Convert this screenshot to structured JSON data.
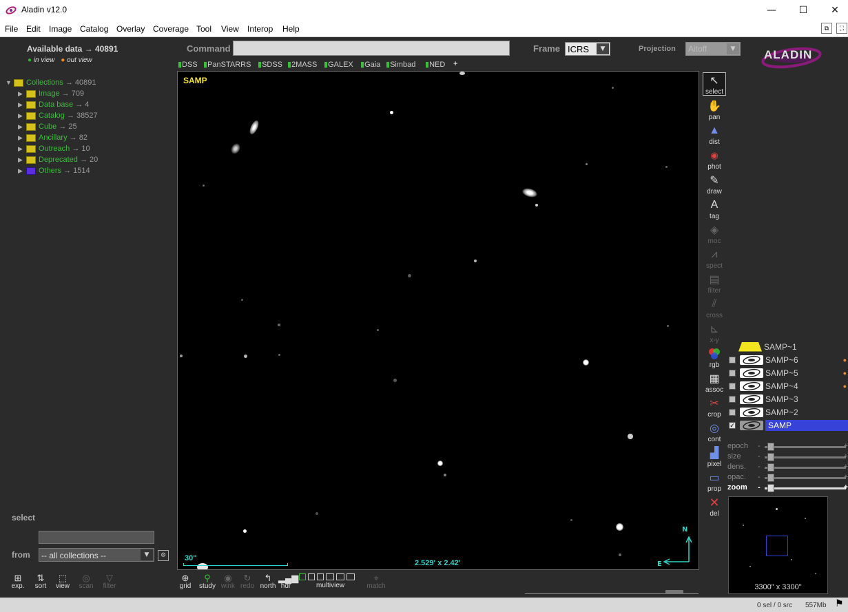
{
  "window": {
    "title": "Aladin v12.0",
    "minimize": "—",
    "maximize": "☐",
    "close": "✕"
  },
  "menu": [
    "File",
    "Edit",
    "Image",
    "Catalog",
    "Overlay",
    "Coverage",
    "Tool",
    "View",
    "Interop",
    "Help"
  ],
  "header": {
    "available_label": "Available data →",
    "available_count": "40891",
    "in_view": "in view",
    "out_view": "out view",
    "command_label": "Command",
    "command_value": "",
    "frame_label": "Frame",
    "frame_value": "ICRS",
    "projection_label": "Projection",
    "projection_value": "Aitoff",
    "logo_text": "ALADIN"
  },
  "bookmarks": [
    "DSS",
    "PanSTARRS",
    "SDSS",
    "2MASS",
    "GALEX",
    "Gaia",
    "Simbad",
    "NED"
  ],
  "bookmark_add": "+",
  "tree": {
    "root": {
      "label": "Collections",
      "count": "→ 40891"
    },
    "items": [
      {
        "label": "Image",
        "count": "→ 709"
      },
      {
        "label": "Data base",
        "count": "→ 4"
      },
      {
        "label": "Catalog",
        "count": "→ 38527"
      },
      {
        "label": "Cube",
        "count": "→ 25"
      },
      {
        "label": "Ancillary",
        "count": "→ 82"
      },
      {
        "label": "Outreach",
        "count": "→ 10"
      },
      {
        "label": "Deprecated",
        "count": "→ 20"
      },
      {
        "label": "Others",
        "count": "→ 1514"
      }
    ]
  },
  "view": {
    "label": "SAMP",
    "scale": "30\"",
    "size": "2.529' x 2.42'",
    "north": "N",
    "east": "E"
  },
  "left_bottom": {
    "select_label": "select",
    "from_label": "from",
    "from_value": "-- all collections --",
    "buttons": [
      "exp.",
      "sort",
      "view",
      "scan",
      "filter"
    ]
  },
  "tools": [
    {
      "label": "select",
      "icon": "arrow-icon",
      "enabled": true
    },
    {
      "label": "pan",
      "icon": "hand-icon",
      "enabled": true
    },
    {
      "label": "dist",
      "icon": "dist-icon",
      "enabled": true
    },
    {
      "label": "phot",
      "icon": "phot-icon",
      "enabled": true
    },
    {
      "label": "draw",
      "icon": "pencil-icon",
      "enabled": true
    },
    {
      "label": "tag",
      "icon": "tag-icon",
      "enabled": true
    },
    {
      "label": "moc",
      "icon": "moc-icon",
      "enabled": false
    },
    {
      "label": "spect",
      "icon": "spect-icon",
      "enabled": false
    },
    {
      "label": "filter",
      "icon": "filter-icon",
      "enabled": false
    },
    {
      "label": "cross",
      "icon": "cross-icon",
      "enabled": false
    },
    {
      "label": "x-y",
      "icon": "xy-icon",
      "enabled": false
    },
    {
      "label": "rgb",
      "icon": "rgb-icon",
      "enabled": true
    },
    {
      "label": "assoc",
      "icon": "film-icon",
      "enabled": true
    },
    {
      "label": "crop",
      "icon": "scissors-icon",
      "enabled": true
    },
    {
      "label": "cont",
      "icon": "contour-icon",
      "enabled": true
    },
    {
      "label": "pixel",
      "icon": "histogram-icon",
      "enabled": true
    },
    {
      "label": "prop",
      "icon": "prop-icon",
      "enabled": true
    },
    {
      "label": "del",
      "icon": "delete-icon",
      "enabled": true
    }
  ],
  "layers": {
    "top": "SAMP~1",
    "items": [
      "SAMP~6",
      "SAMP~5",
      "SAMP~4",
      "SAMP~3",
      "SAMP~2",
      "SAMP"
    ],
    "selected": "SAMP"
  },
  "sliders": [
    "epoch",
    "size",
    "dens.",
    "opac.",
    "zoom"
  ],
  "thumbnail_label": "3300\" x 3300\"",
  "bottom_tools": [
    {
      "label": "grid",
      "enabled": true
    },
    {
      "label": "study",
      "enabled": true
    },
    {
      "label": "wink",
      "enabled": false
    },
    {
      "label": "redo",
      "enabled": false
    },
    {
      "label": "north",
      "enabled": true
    },
    {
      "label": "hdr",
      "enabled": true
    }
  ],
  "multiview_label": "multiview",
  "match_label": "match",
  "status": {
    "sel": "0 sel / 0 src",
    "mem": "557Mb"
  },
  "colors": {
    "accent_green": "#3bbf3b",
    "in_view": "#2fb52f",
    "out_view": "#ef8a28",
    "scale_cyan": "#32d6c8",
    "samp_label": "#f2e51e",
    "selected_layer": "#3742d8"
  }
}
